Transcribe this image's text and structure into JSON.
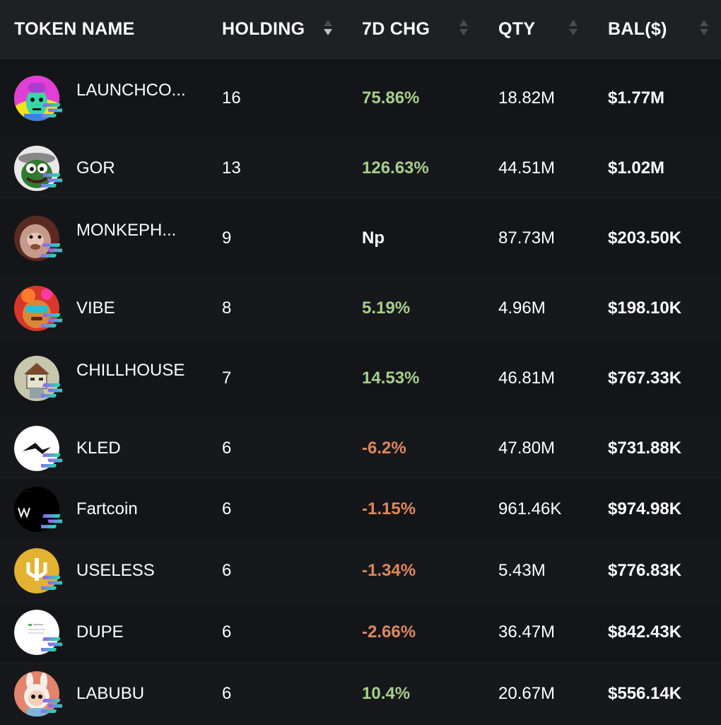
{
  "header": {
    "token_name": "TOKEN NAME",
    "holding": "HOLDING",
    "chg": "7D CHG",
    "qty": "QTY",
    "bal": "BAL($)"
  },
  "colors": {
    "positive": "#a6d08a",
    "negative": "#e0885a"
  },
  "rows": [
    {
      "name": "LAUNCHCO...",
      "holding": "16",
      "chg": "75.86%",
      "trend": "positive",
      "qty": "18.82M",
      "bal": "$1.77M",
      "icon": "launchcoin-avatar-icon"
    },
    {
      "name": "GOR",
      "holding": "13",
      "chg": "126.63%",
      "trend": "positive",
      "qty": "44.51M",
      "bal": "$1.02M",
      "icon": "gor-avatar-icon"
    },
    {
      "name": "MONKEPH...",
      "holding": "9",
      "chg": "Np",
      "trend": "neutral",
      "qty": "87.73M",
      "bal": "$203.50K",
      "icon": "monkeph-avatar-icon"
    },
    {
      "name": "VIBE",
      "holding": "8",
      "chg": "5.19%",
      "trend": "positive",
      "qty": "4.96M",
      "bal": "$198.10K",
      "icon": "vibe-avatar-icon"
    },
    {
      "name": "CHILLHOUSE",
      "holding": "7",
      "chg": "14.53%",
      "trend": "positive",
      "qty": "46.81M",
      "bal": "$767.33K",
      "icon": "chillhouse-avatar-icon"
    },
    {
      "name": "KLED",
      "holding": "6",
      "chg": "-6.2%",
      "trend": "negative",
      "qty": "47.80M",
      "bal": "$731.88K",
      "icon": "kled-avatar-icon"
    },
    {
      "name": "Fartcoin",
      "holding": "6",
      "chg": "-1.15%",
      "trend": "negative",
      "qty": "961.46K",
      "bal": "$974.98K",
      "icon": "fartcoin-avatar-icon"
    },
    {
      "name": "USELESS",
      "holding": "6",
      "chg": "-1.34%",
      "trend": "negative",
      "qty": "5.43M",
      "bal": "$776.83K",
      "icon": "useless-avatar-icon"
    },
    {
      "name": "DUPE",
      "holding": "6",
      "chg": "-2.66%",
      "trend": "negative",
      "qty": "36.47M",
      "bal": "$842.43K",
      "icon": "dupe-avatar-icon"
    },
    {
      "name": "LABUBU",
      "holding": "6",
      "chg": "10.4%",
      "trend": "positive",
      "qty": "20.67M",
      "bal": "$556.14K",
      "icon": "labubu-avatar-icon"
    }
  ]
}
